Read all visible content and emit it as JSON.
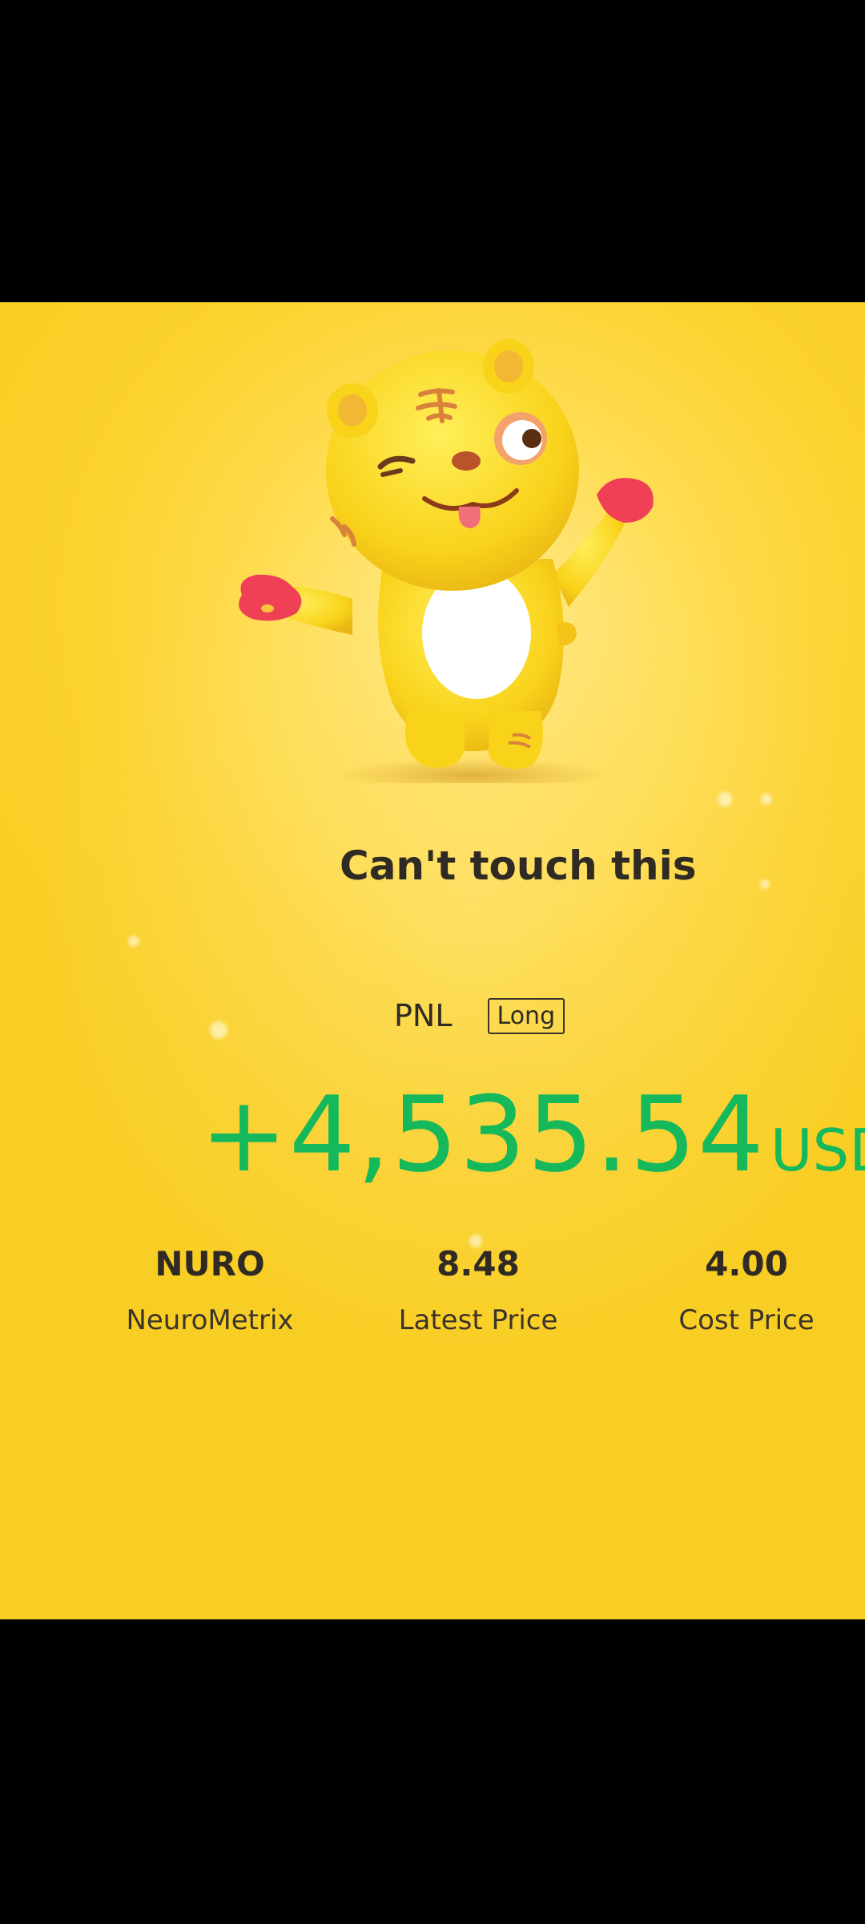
{
  "card": {
    "headline": "Can't touch this",
    "mascot_icon": "tiger-mascot-icon"
  },
  "pnl": {
    "label": "PNL",
    "position_type": "Long",
    "amount": "+4,535.54",
    "currency": "USD",
    "color": "#15b85a"
  },
  "stats": [
    {
      "value": "NURO",
      "label": "NeuroMetrix"
    },
    {
      "value": "8.48",
      "label": "Latest Price"
    },
    {
      "value": "4.00",
      "label": "Cost Price"
    }
  ],
  "colors": {
    "background": "#fcd22e",
    "text": "#2f2a23"
  }
}
